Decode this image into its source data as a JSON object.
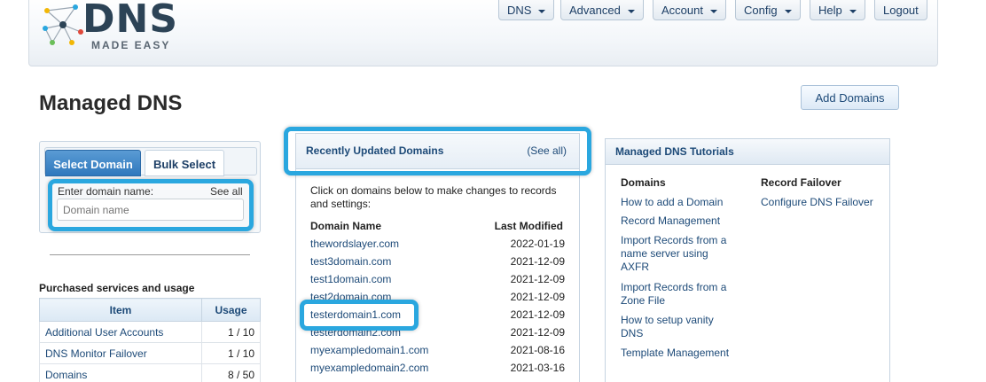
{
  "logo": {
    "main": "DNS",
    "sub": "MADE EASY"
  },
  "nav": {
    "items": [
      {
        "label": "DNS"
      },
      {
        "label": "Advanced"
      },
      {
        "label": "Account"
      },
      {
        "label": "Config"
      },
      {
        "label": "Help"
      }
    ],
    "logout": "Logout"
  },
  "page": {
    "title": "Managed DNS",
    "add_button": "Add Domains"
  },
  "select_box": {
    "tabs": [
      "Select Domain",
      "Bulk Select"
    ],
    "active_tab": "Select Domain",
    "enter_label": "Enter domain name:",
    "see_all": "See all",
    "input_placeholder": "Domain name",
    "input_value": ""
  },
  "services": {
    "title": "Purchased services and usage",
    "headers": [
      "Item",
      "Usage"
    ],
    "rows": [
      {
        "item": "Additional User Accounts",
        "usage": "1 / 10"
      },
      {
        "item": "DNS Monitor Failover",
        "usage": "1 / 10"
      },
      {
        "item": "Domains",
        "usage": "8 / 50"
      }
    ]
  },
  "recent": {
    "title": "Recently Updated Domains",
    "see_all": "(See all)",
    "intro": "Click on domains below to make changes to records and settings:",
    "col_domain": "Domain Name",
    "col_modified": "Last Modified",
    "rows": [
      {
        "domain": "thewordslayer.com",
        "date": "2022-01-19"
      },
      {
        "domain": "test3domain.com",
        "date": "2021-12-09"
      },
      {
        "domain": "test1domain.com",
        "date": "2021-12-09"
      },
      {
        "domain": "test2domain.com",
        "date": "2021-12-09"
      },
      {
        "domain": "testerdomain1.com",
        "date": "2021-12-09"
      },
      {
        "domain": "testerdomain2.com",
        "date": "2021-12-09"
      },
      {
        "domain": "myexampledomain1.com",
        "date": "2021-08-16"
      },
      {
        "domain": "myexampledomain2.com",
        "date": "2021-03-16"
      }
    ]
  },
  "tutorials": {
    "title": "Managed DNS Tutorials",
    "domains_header": "Domains",
    "domains_links": [
      "How to add a Domain",
      "Record Management",
      "Import Records from a name server using AXFR",
      "Import Records from a Zone File",
      "How to setup vanity DNS",
      "Template Management"
    ],
    "failover_header": "Record Failover",
    "failover_links": [
      "Configure DNS Failover"
    ]
  },
  "colors": {
    "accent": "#2f78bd",
    "highlight": "#2aa7df",
    "link": "#1d4a78"
  }
}
